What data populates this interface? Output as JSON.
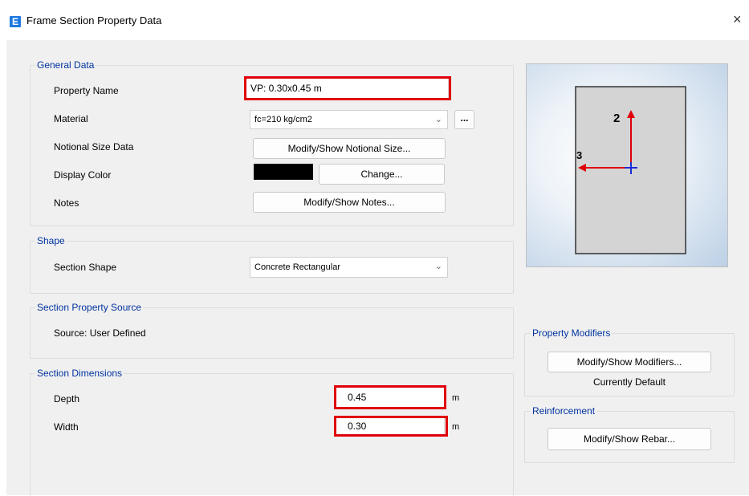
{
  "window": {
    "title": "Frame Section Property Data",
    "close_glyph": "×",
    "app_icon_letter": "E"
  },
  "general": {
    "legend": "General Data",
    "property_name_label": "Property Name",
    "property_name_value": "VP: 0.30x0.45 m",
    "material_label": "Material",
    "material_value": "fc=210 kg/cm2",
    "material_more": "...",
    "notional_label": "Notional Size Data",
    "notional_button": "Modify/Show Notional Size...",
    "color_label": "Display Color",
    "color_swatch": "#000000",
    "color_button": "Change...",
    "notes_label": "Notes",
    "notes_button": "Modify/Show Notes..."
  },
  "shape": {
    "legend": "Shape",
    "section_shape_label": "Section Shape",
    "section_shape_value": "Concrete Rectangular"
  },
  "source": {
    "legend": "Section Property Source",
    "source_text": "Source:  User Defined"
  },
  "dimensions": {
    "legend": "Section Dimensions",
    "depth_label": "Depth",
    "depth_value": "0.45",
    "depth_unit": "m",
    "width_label": "Width",
    "width_value": "0.30",
    "width_unit": "m"
  },
  "preview": {
    "axis2_label": "2",
    "axis3_label": "3"
  },
  "modifiers": {
    "legend": "Property Modifiers",
    "button": "Modify/Show Modifiers...",
    "status": "Currently Default"
  },
  "reinforcement": {
    "legend": "Reinforcement",
    "button": "Modify/Show Rebar..."
  },
  "colors": {
    "highlight": "#e0000a",
    "legend_text": "#0033a0",
    "axis_red": "#e0000a",
    "axis_blue": "#1a2bd6"
  }
}
